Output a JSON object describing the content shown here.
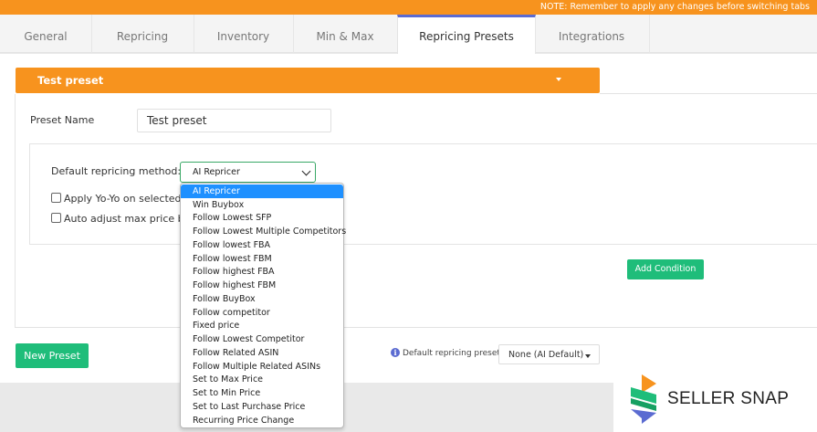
{
  "note": "NOTE: Remember to apply any changes before switching tabs",
  "tabs": [
    {
      "label": "General"
    },
    {
      "label": "Repricing"
    },
    {
      "label": "Inventory"
    },
    {
      "label": "Min & Max"
    },
    {
      "label": "Repricing Presets"
    },
    {
      "label": "Integrations"
    }
  ],
  "preset": {
    "header_title": "Test preset",
    "name_label": "Preset Name",
    "name_value": "Test preset",
    "method_label": "Default repricing method:",
    "method_value": "AI Repricer",
    "yoyo_label": "Apply Yo-Yo on selected r",
    "auto_adjust_label": "Auto adjust max price ba",
    "add_condition_label": "Add Condition"
  },
  "dropdown": {
    "options": [
      "AI Repricer",
      "Win Buybox",
      "Follow Lowest SFP",
      "Follow Lowest Multiple Competitors",
      "Follow lowest FBA",
      "Follow lowest FBM",
      "Follow highest FBA",
      "Follow highest FBM",
      "Follow BuyBox",
      "Follow competitor",
      "Fixed price",
      "Follow Lowest Competitor",
      "Follow Related ASIN",
      "Follow Multiple Related ASINs",
      "Set to Max Price",
      "Set to Min Price",
      "Set to Last Purchase Price",
      "Recurring Price Change"
    ],
    "selected": "AI Repricer"
  },
  "footer": {
    "new_preset_label": "New Preset",
    "default_preset_label": "Default repricing preset:",
    "default_preset_value": "None (AI Default)"
  },
  "logo": {
    "text": "SELLER SNAP"
  },
  "colors": {
    "accent_orange": "#f7931e",
    "green_button": "#1fbd7a",
    "tab_indicator": "#5b6bd1",
    "dropdown_highlight": "#1e90ff"
  }
}
